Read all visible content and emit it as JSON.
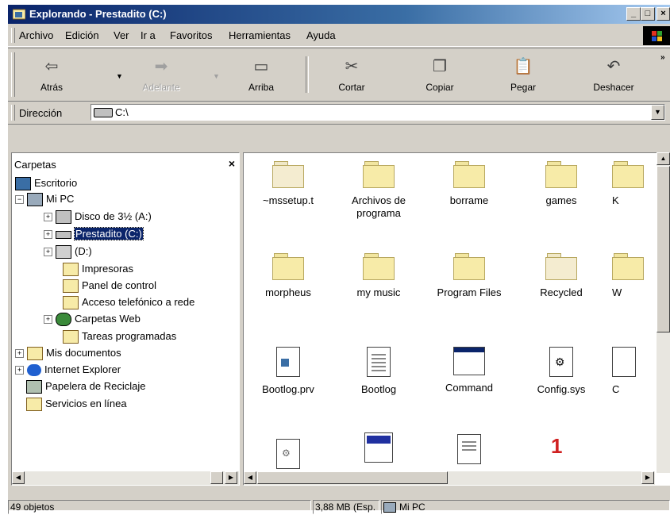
{
  "window": {
    "title": "Explorando - Prestadito (C:)",
    "controls": [
      "minimize",
      "maximize",
      "close"
    ]
  },
  "menu": [
    {
      "label": "Archivo"
    },
    {
      "label": "Edición"
    },
    {
      "label": "Ver"
    },
    {
      "label": "Ir a"
    },
    {
      "label": "Favoritos"
    },
    {
      "label": "Herramientas"
    },
    {
      "label": "Ayuda"
    }
  ],
  "toolbar": {
    "back": "Atrás",
    "forward": "Adelante",
    "up": "Arriba",
    "cut": "Cortar",
    "copy": "Copiar",
    "paste": "Pegar",
    "undo": "Deshacer"
  },
  "address": {
    "label": "Dirección",
    "value": "C:\\"
  },
  "folders_panel": {
    "title": "Carpetas",
    "close": "×",
    "tree": [
      {
        "label": "Escritorio"
      },
      {
        "label": "Mi PC"
      },
      {
        "label": "Disco de 3½ (A:)"
      },
      {
        "label": "Prestadito (C:)"
      },
      {
        "label": "(D:)"
      },
      {
        "label": "Impresoras"
      },
      {
        "label": "Panel de control"
      },
      {
        "label": "Acceso telefónico a rede"
      },
      {
        "label": "Carpetas Web"
      },
      {
        "label": "Tareas programadas"
      },
      {
        "label": "Mis documentos"
      },
      {
        "label": "Internet Explorer"
      },
      {
        "label": "Papelera de Reciclaje"
      },
      {
        "label": "Servicios en línea"
      }
    ]
  },
  "files": [
    {
      "name": "~mssetup.t",
      "icon": "folder-pale"
    },
    {
      "name": "Archivos de programa",
      "icon": "folder"
    },
    {
      "name": "borrame",
      "icon": "folder"
    },
    {
      "name": "games",
      "icon": "folder"
    },
    {
      "name": "K",
      "icon": "folder"
    },
    {
      "name": "morpheus",
      "icon": "folder"
    },
    {
      "name": "my music",
      "icon": "folder"
    },
    {
      "name": "Program Files",
      "icon": "folder"
    },
    {
      "name": "Recycled",
      "icon": "folder-pale"
    },
    {
      "name": "W",
      "icon": "folder"
    },
    {
      "name": "Bootlog.prv",
      "icon": "prv-file-icon"
    },
    {
      "name": "Bootlog",
      "icon": "text-file-icon"
    },
    {
      "name": "Command",
      "icon": "window-app-icon"
    },
    {
      "name": "Config.sys",
      "icon": "system-file-icon"
    },
    {
      "name": "C",
      "icon": "file"
    }
  ],
  "status": {
    "count": "49 objetos",
    "size": "3,88 MB (Esp.",
    "location": "Mi PC"
  }
}
